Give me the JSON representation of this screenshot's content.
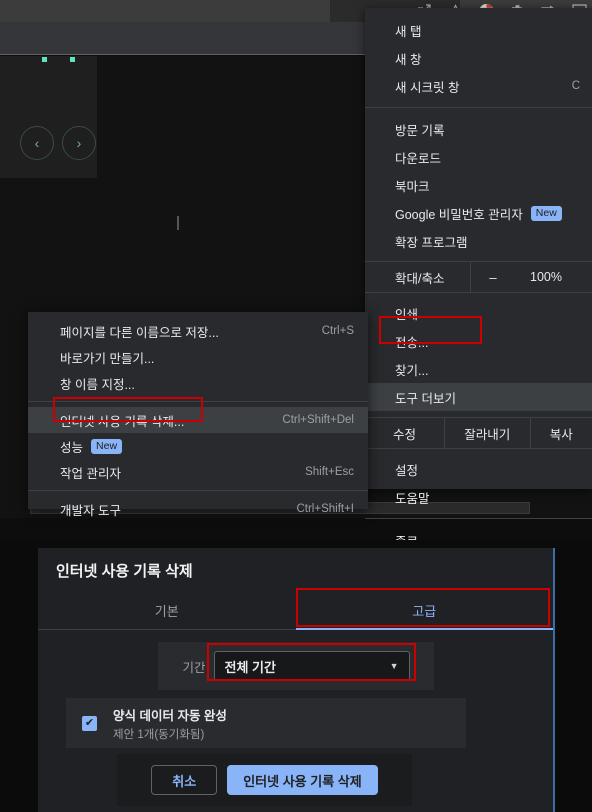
{
  "browser": {
    "toolbar_icons": [
      {
        "name": "share-icon"
      },
      {
        "name": "bookmark-star-icon"
      },
      {
        "name": "chrome-profile-icon"
      },
      {
        "name": "extensions-puzzle-icon"
      },
      {
        "name": "downloads-tray-icon"
      },
      {
        "name": "menu-more-icon"
      }
    ],
    "page": {
      "nav_prev": "‹",
      "nav_next": "›"
    }
  },
  "chrome_menu": {
    "groups": [
      {
        "items": [
          {
            "label": "새 탭",
            "accel": "",
            "badge": ""
          },
          {
            "label": "새 창",
            "accel": "",
            "badge": ""
          },
          {
            "label": "새 시크릿 창",
            "accel": "C",
            "badge": ""
          }
        ]
      },
      {
        "items": [
          {
            "label": "방문 기록",
            "accel": "",
            "badge": ""
          },
          {
            "label": "다운로드",
            "accel": "",
            "badge": ""
          },
          {
            "label": "북마크",
            "accel": "",
            "badge": ""
          },
          {
            "label": "Google 비밀번호 관리자",
            "accel": "",
            "badge": "New"
          },
          {
            "label": "확장 프로그램",
            "accel": "",
            "badge": ""
          }
        ]
      }
    ],
    "zoom_row": {
      "label": "확대/축소",
      "minus": "–",
      "value": "100%"
    },
    "group3": [
      {
        "label": "인쇄",
        "accel": "",
        "badge": ""
      },
      {
        "label": "전송...",
        "accel": "",
        "badge": ""
      },
      {
        "label": "찾기...",
        "accel": "",
        "badge": ""
      },
      {
        "label": "도구 더보기",
        "accel": "",
        "badge": "",
        "highlighted": true
      }
    ],
    "edit_row": {
      "label": "수정",
      "cut": "잘라내기",
      "copy": "복사"
    },
    "group4": [
      {
        "label": "설정",
        "accel": "",
        "badge": ""
      },
      {
        "label": "도움말",
        "accel": "",
        "badge": ""
      }
    ],
    "group5": [
      {
        "label": "종료",
        "accel": "",
        "badge": ""
      }
    ]
  },
  "submenu": {
    "group1": [
      {
        "label": "페이지를 다른 이름으로 저장...",
        "accel": "Ctrl+S",
        "badge": ""
      },
      {
        "label": "바로가기 만들기...",
        "accel": "",
        "badge": ""
      },
      {
        "label": "창 이름 지정...",
        "accel": "",
        "badge": ""
      }
    ],
    "group2": [
      {
        "label": "인터넷 사용 기록 삭제...",
        "accel": "Ctrl+Shift+Del",
        "badge": "",
        "highlighted": true
      },
      {
        "label": "성능",
        "accel": "",
        "badge": "New"
      },
      {
        "label": "작업 관리자",
        "accel": "Shift+Esc",
        "badge": ""
      }
    ],
    "group3": [
      {
        "label": "개발자 도구",
        "accel": "Ctrl+Shift+I",
        "badge": ""
      }
    ]
  },
  "dialog": {
    "title": "인터넷 사용 기록 삭제",
    "tabs": [
      {
        "label": "기본",
        "active": false
      },
      {
        "label": "고급",
        "active": true
      }
    ],
    "period": {
      "label": "기간",
      "value": "전체 기간",
      "caret": "▼"
    },
    "checkbox": {
      "checked": true,
      "check_glyph": "✔",
      "title": "양식 데이터 자동 완성",
      "subtitle": "제안 1개(동기화됨)"
    },
    "actions": {
      "cancel": "취소",
      "confirm": "인터넷 사용 기록 삭제"
    }
  },
  "annotations": {
    "highlight_color": "#cc0000",
    "boxes": [
      {
        "name": "more-tools-highlight"
      },
      {
        "name": "clear-browsing-data-menu-highlight"
      },
      {
        "name": "advanced-tab-highlight"
      },
      {
        "name": "time-range-select-highlight"
      }
    ]
  },
  "colors": {
    "accent_blue": "#8ab4f8",
    "menu_bg": "#292a2d",
    "dialog_bg": "#202124",
    "highlight_red": "#cc0000"
  }
}
